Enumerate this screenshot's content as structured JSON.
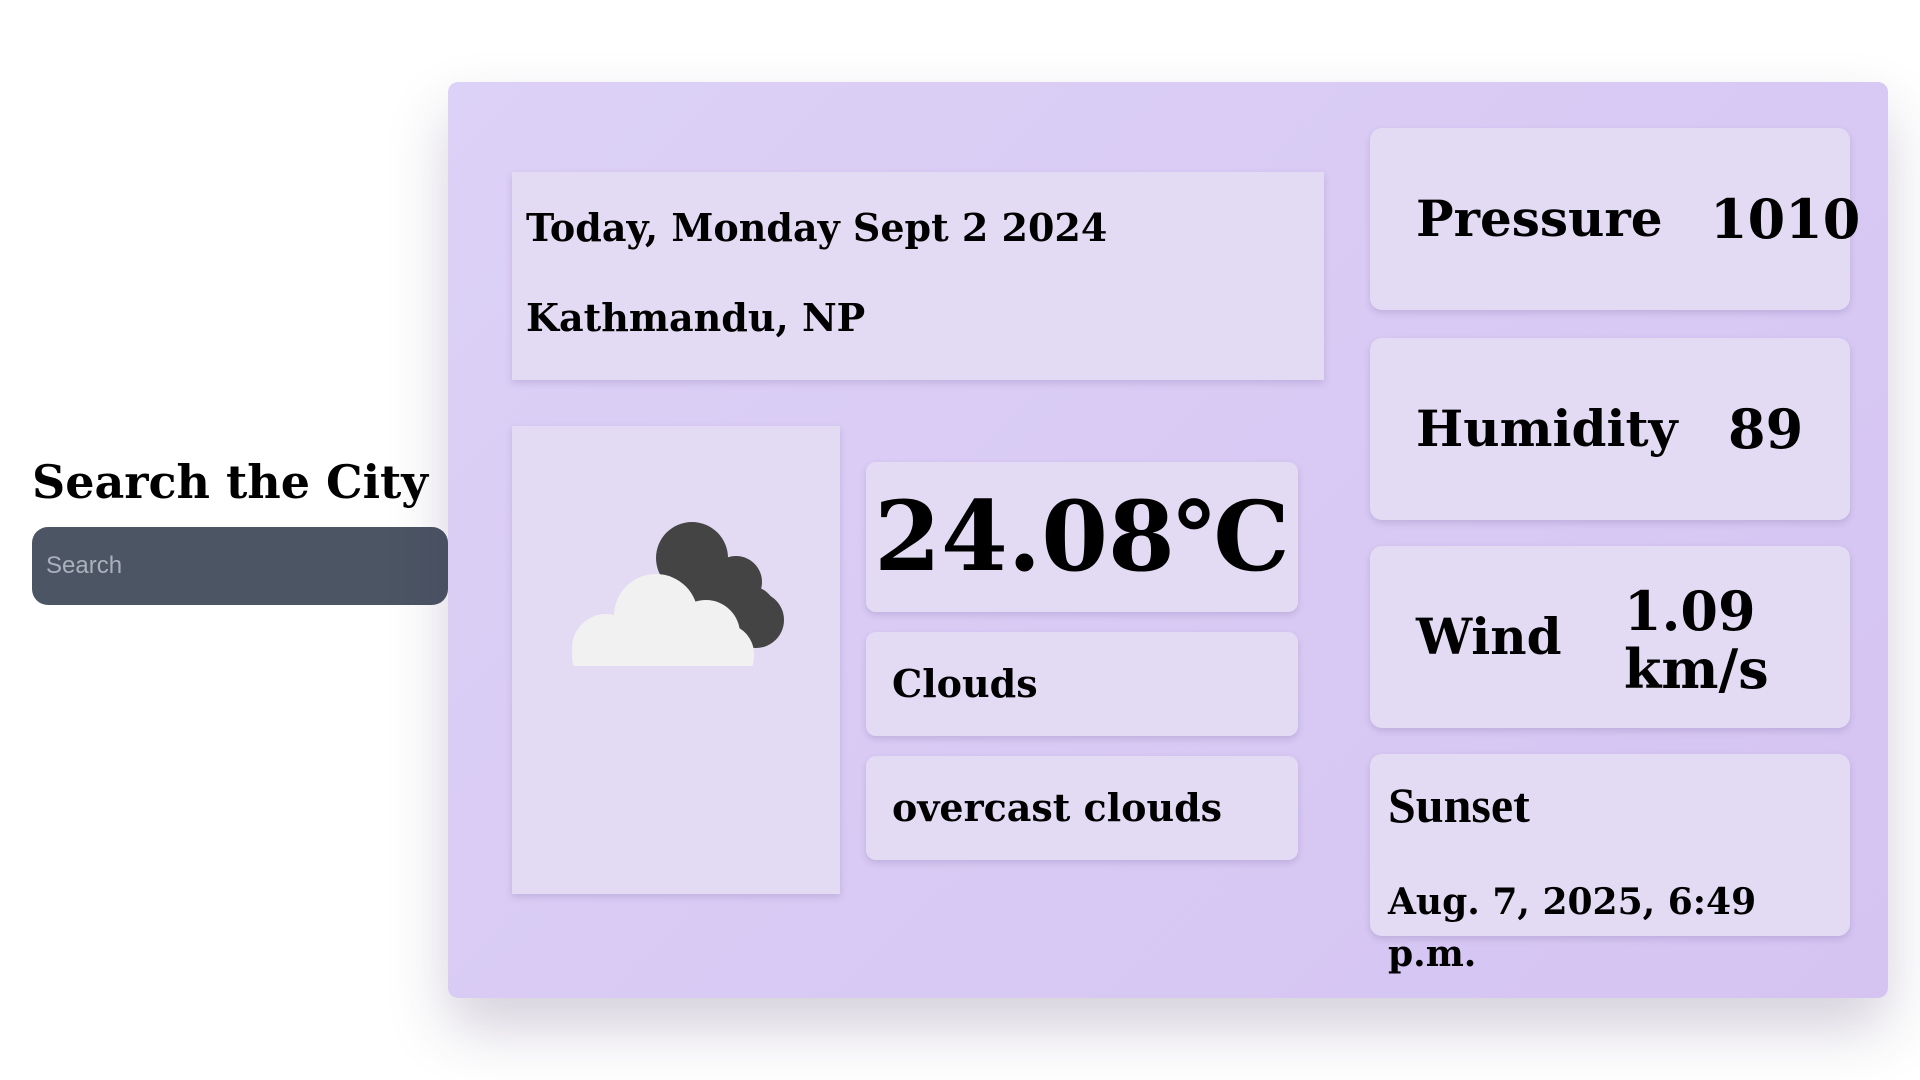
{
  "search": {
    "title": "Search the City",
    "placeholder": "Search"
  },
  "weather": {
    "date": "Today, Monday Sept 2 2024",
    "location": "Kathmandu, NP",
    "icon": "cloud-icon",
    "temperature": "24.08℃",
    "condition": "Clouds",
    "description": "overcast clouds"
  },
  "stats": {
    "pressure": {
      "label": "Pressure",
      "value": "1010"
    },
    "humidity": {
      "label": "Humidity",
      "value": "89"
    },
    "wind": {
      "label": "Wind",
      "value": "1.09 km/s"
    },
    "sunset": {
      "label": "Sunset",
      "value": "Aug. 7, 2025, 6:49 p.m."
    }
  },
  "colors": {
    "panel": "#d8c9f4",
    "card": "#e3dbf3",
    "search_bg": "#4b5563",
    "cloud_front": "#f1f1f1",
    "cloud_back": "#444444"
  }
}
